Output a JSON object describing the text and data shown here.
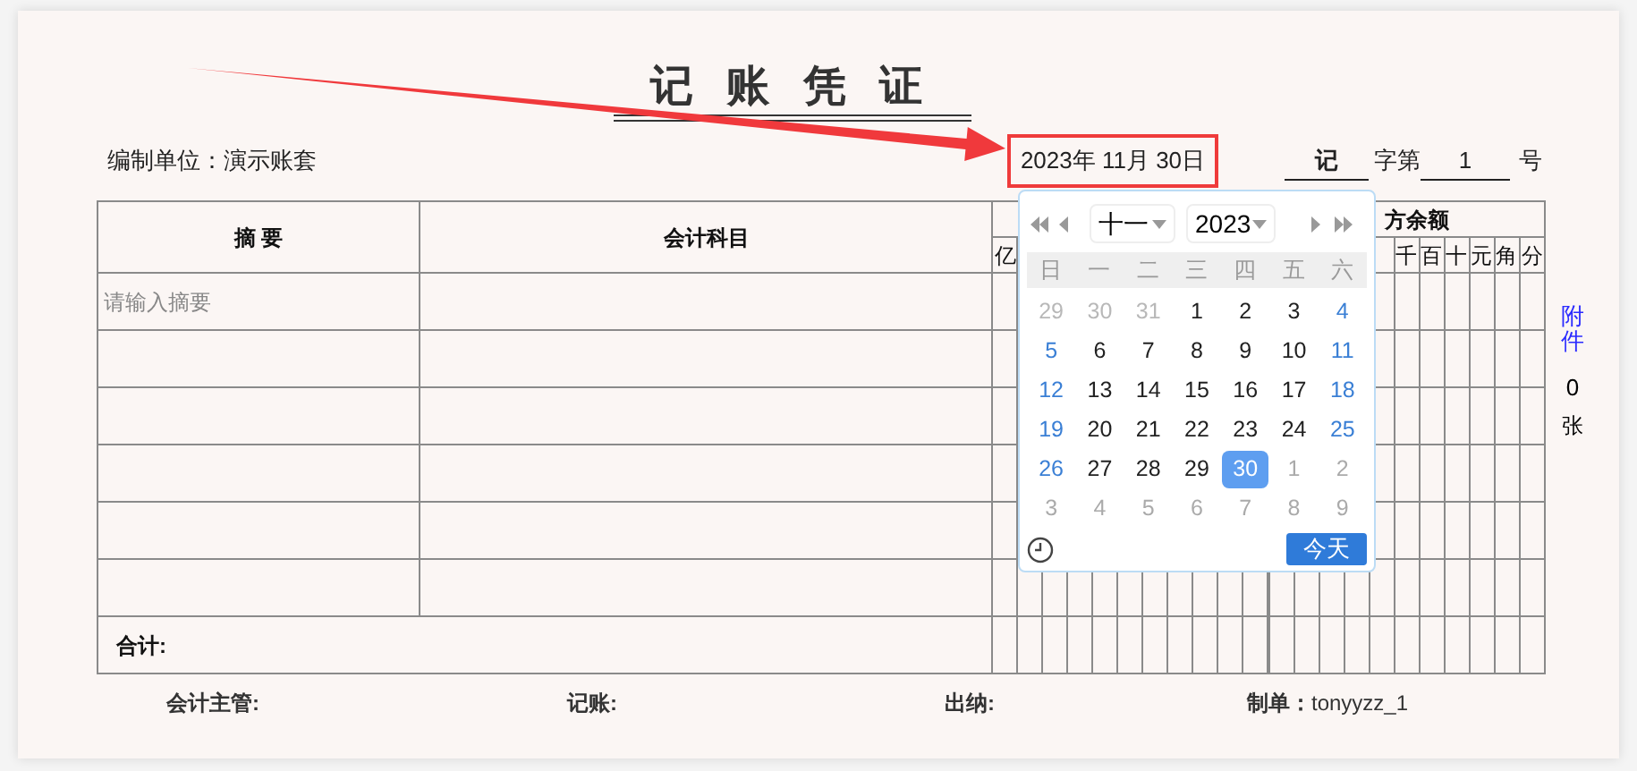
{
  "title": "记 账 凭 证",
  "unit_label": "编制单位：演示账套",
  "date": {
    "value": "2023年 11月 30日",
    "highlighted": true
  },
  "voucher_word": "记",
  "word_label": "字第",
  "number": "1",
  "number_suffix": "号",
  "table": {
    "columns": [
      "摘 要",
      "会计科目"
    ],
    "credit_group_header": "方余额",
    "debit_digits": [
      "亿"
    ],
    "credit_digits": [
      "千",
      "百",
      "十",
      "元",
      "角",
      "分"
    ],
    "rows": [
      {
        "kind": "input",
        "placeholder": "请输入摘要"
      },
      {
        "kind": "blank"
      },
      {
        "kind": "blank"
      },
      {
        "kind": "blank"
      },
      {
        "kind": "blank"
      },
      {
        "kind": "blank"
      }
    ],
    "total_label": "合计:"
  },
  "attachments": {
    "label": "附件",
    "count": "0",
    "unit": "张"
  },
  "signatures": [
    {
      "label": "会计主管:"
    },
    {
      "label": "记账:"
    },
    {
      "label": "出纳:"
    },
    {
      "label": "制单：",
      "value": "tonyyzz_1"
    }
  ],
  "date_picker": {
    "month": "十一",
    "year": "2023",
    "weekdays": [
      "日",
      "一",
      "二",
      "三",
      "四",
      "五",
      "六"
    ],
    "days": [
      {
        "label": "29",
        "kind": "prev",
        "selected": false
      },
      {
        "label": "30",
        "kind": "prev",
        "selected": false
      },
      {
        "label": "31",
        "kind": "prev",
        "selected": false
      },
      {
        "label": "1",
        "kind": "cur",
        "selected": false
      },
      {
        "label": "2",
        "kind": "cur",
        "selected": false
      },
      {
        "label": "3",
        "kind": "cur",
        "selected": false
      },
      {
        "label": "4",
        "kind": "cur",
        "selected": false
      },
      {
        "label": "5",
        "kind": "cur",
        "selected": false
      },
      {
        "label": "6",
        "kind": "cur",
        "selected": false
      },
      {
        "label": "7",
        "kind": "cur",
        "selected": false
      },
      {
        "label": "8",
        "kind": "cur",
        "selected": false
      },
      {
        "label": "9",
        "kind": "cur",
        "selected": false
      },
      {
        "label": "10",
        "kind": "cur",
        "selected": false
      },
      {
        "label": "11",
        "kind": "cur",
        "selected": false
      },
      {
        "label": "12",
        "kind": "cur",
        "selected": false
      },
      {
        "label": "13",
        "kind": "cur",
        "selected": false
      },
      {
        "label": "14",
        "kind": "cur",
        "selected": false
      },
      {
        "label": "15",
        "kind": "cur",
        "selected": false
      },
      {
        "label": "16",
        "kind": "cur",
        "selected": false
      },
      {
        "label": "17",
        "kind": "cur",
        "selected": false
      },
      {
        "label": "18",
        "kind": "cur",
        "selected": false
      },
      {
        "label": "19",
        "kind": "cur",
        "selected": false
      },
      {
        "label": "20",
        "kind": "cur",
        "selected": false
      },
      {
        "label": "21",
        "kind": "cur",
        "selected": false
      },
      {
        "label": "22",
        "kind": "cur",
        "selected": false
      },
      {
        "label": "23",
        "kind": "cur",
        "selected": false
      },
      {
        "label": "24",
        "kind": "cur",
        "selected": false
      },
      {
        "label": "25",
        "kind": "cur",
        "selected": false
      },
      {
        "label": "26",
        "kind": "cur",
        "selected": false
      },
      {
        "label": "27",
        "kind": "cur",
        "selected": false
      },
      {
        "label": "28",
        "kind": "cur",
        "selected": false
      },
      {
        "label": "29",
        "kind": "cur",
        "selected": false
      },
      {
        "label": "30",
        "kind": "cur",
        "selected": true
      },
      {
        "label": "1",
        "kind": "next",
        "selected": false
      },
      {
        "label": "2",
        "kind": "next",
        "selected": false
      },
      {
        "label": "3",
        "kind": "next",
        "selected": false
      },
      {
        "label": "4",
        "kind": "next",
        "selected": false
      },
      {
        "label": "5",
        "kind": "next",
        "selected": false
      },
      {
        "label": "6",
        "kind": "next",
        "selected": false
      },
      {
        "label": "7",
        "kind": "next",
        "selected": false
      },
      {
        "label": "8",
        "kind": "next",
        "selected": false
      },
      {
        "label": "9",
        "kind": "next",
        "selected": false
      }
    ],
    "today_button": "今天"
  }
}
